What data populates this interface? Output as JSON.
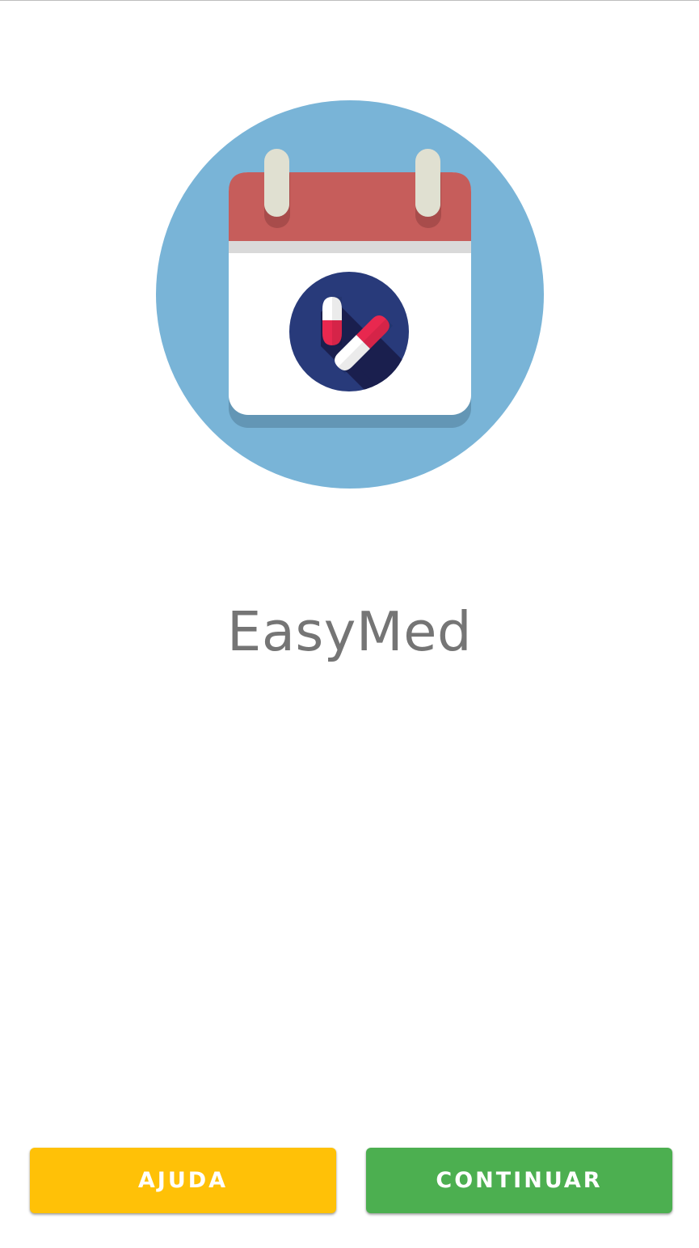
{
  "app": {
    "title": "EasyMed",
    "logo_icon": "calendar-pill-icon"
  },
  "actions": {
    "help_label": "AJUDA",
    "continue_label": "CONTINUAR"
  },
  "colors": {
    "help_button": "#ffc107",
    "continue_button": "#4caf50",
    "logo_background": "#79b4d7",
    "calendar_header": "#c65d5b",
    "pill_circle": "#283a7a",
    "title_text": "#757575"
  }
}
